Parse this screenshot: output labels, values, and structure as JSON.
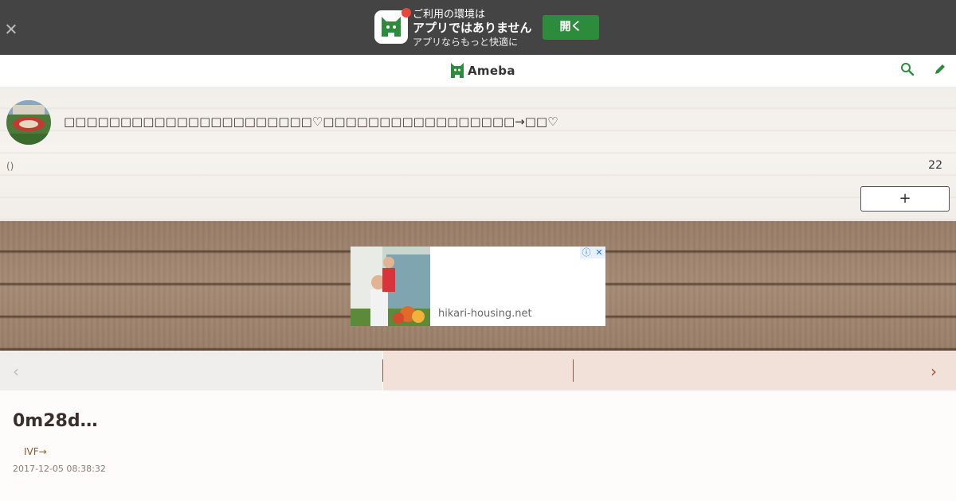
{
  "app_banner": {
    "line1": "ご利用の環境は",
    "line2": "アプリではありません",
    "line3": "アプリならもっと快適に",
    "open_label": "開く"
  },
  "header": {
    "logo_text": "Ameba"
  },
  "blog": {
    "title": "□□□□□□□□□□□□□□□□□□□□□□♡□□□□□□□□□□□□□□□□□→□□♡",
    "subtitle": "()",
    "count": "22",
    "reader_button": "+"
  },
  "ad": {
    "domain": "hikari-housing.net",
    "info_icon": "ⓘ",
    "close_icon": "✕"
  },
  "nav": {
    "prev_icon": "‹",
    "next_icon": "›"
  },
  "entry": {
    "title": "0m28d…",
    "theme": "IVF→",
    "date": "2017-12-05 08:38:32"
  },
  "colors": {
    "banner_bg": "#444444",
    "open_button": "#2d8c3c",
    "accent_brown": "#a0522d",
    "next_bg": "#f1e1d8"
  }
}
